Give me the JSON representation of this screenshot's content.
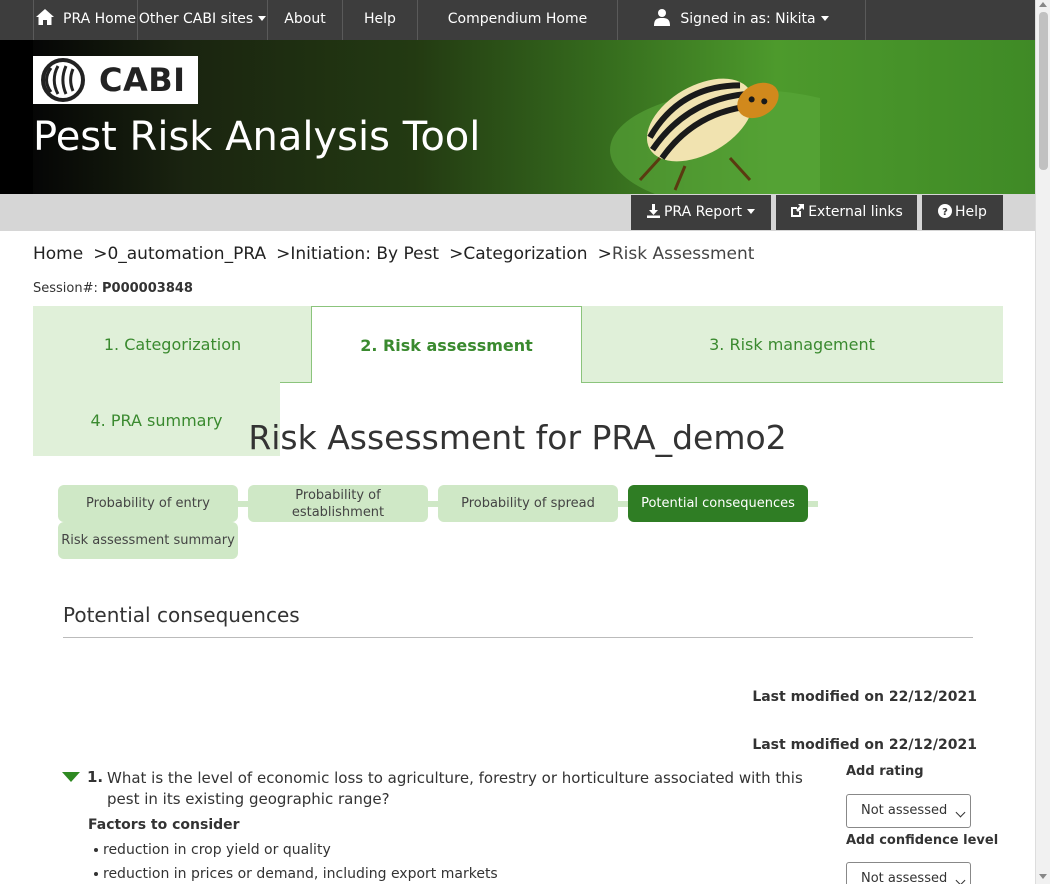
{
  "topnav": {
    "home": "PRA Home",
    "other_sites": "Other CABI sites",
    "about": "About",
    "help": "Help",
    "compendium": "Compendium Home",
    "signed_in": "Signed in as: Nikita",
    "home_icon": "home-icon",
    "user_icon": "user-icon"
  },
  "banner": {
    "logo_text": "CABI",
    "title": "Pest Risk Analysis Tool"
  },
  "toolbar": {
    "report": "PRA Report",
    "external_links": "External links",
    "help": "Help"
  },
  "breadcrumb": {
    "items": [
      "Home",
      "0_automation_PRA",
      "Initiation: By Pest",
      "Categorization",
      "Risk Assessment"
    ]
  },
  "session": {
    "label": "Session#:",
    "value": "P000003848"
  },
  "tabs": [
    {
      "label": "1. Categorization"
    },
    {
      "label": "2. Risk assessment"
    },
    {
      "label": "3. Risk management"
    },
    {
      "label": "4. PRA summary"
    }
  ],
  "main": {
    "title": "Risk Assessment for PRA_demo2"
  },
  "steps": [
    {
      "label": "Probability of entry"
    },
    {
      "label": "Probability of establishment"
    },
    {
      "label": "Probability of spread"
    },
    {
      "label": "Potential consequences"
    },
    {
      "label": "Risk assessment summary"
    }
  ],
  "section": {
    "title": "Potential consequences",
    "last_modified_1": "Last modified on 22/12/2021",
    "last_modified_2": "Last modified on 22/12/2021"
  },
  "question": {
    "number": "1.",
    "text": "What is the level of economic loss to agriculture, forestry or horticulture associated with this pest in its existing geographic range?",
    "factors_label": "Factors to consider",
    "factors": [
      "reduction in crop yield or quality",
      "reduction in prices or demand, including export markets"
    ],
    "rating_label": "Add rating",
    "rating_value": "Not assessed",
    "confidence_label": "Add confidence level",
    "confidence_value": "Not assessed"
  },
  "colors": {
    "nav_bg": "#3d3d3d",
    "tab_bg": "#e0f0d9",
    "tab_text": "#3a8a2f",
    "active_step": "#2f7d24",
    "step_bg": "#cfe8c6"
  }
}
